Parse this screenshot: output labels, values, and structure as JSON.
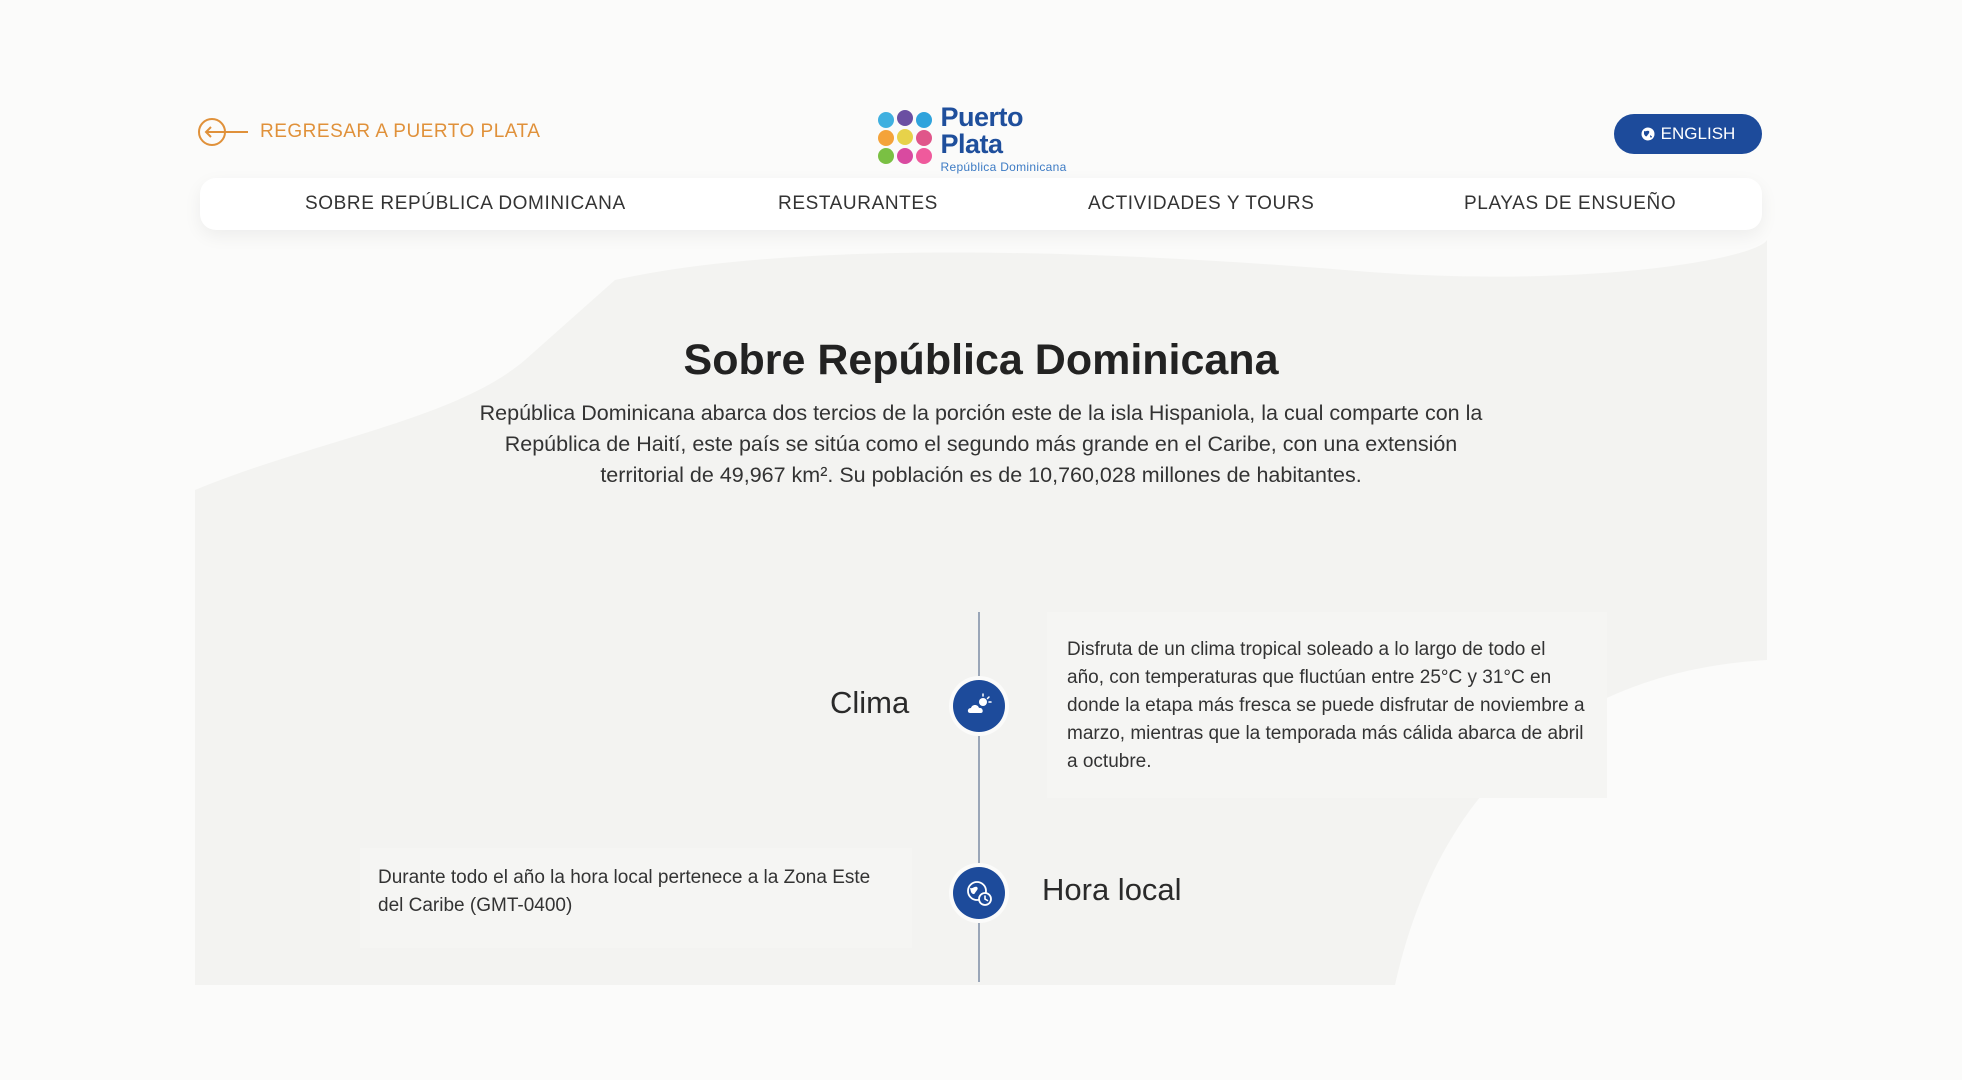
{
  "header": {
    "back_label": "REGRESAR A PUERTO PLATA",
    "logo": {
      "name": "Puerto Plata",
      "subtitle": "República Dominicana"
    },
    "language_button": "ENGLISH"
  },
  "nav": {
    "items": [
      {
        "label": "SOBRE REPÚBLICA DOMINICANA"
      },
      {
        "label": "RESTAURANTES"
      },
      {
        "label": "ACTIVIDADES Y TOURS"
      },
      {
        "label": "PLAYAS DE ENSUEÑO"
      }
    ]
  },
  "main": {
    "title": "Sobre República Dominicana",
    "intro": "República Dominicana abarca dos tercios de la porción este de la isla Hispaniola, la cual comparte con la República de Haití, este país se sitúa como el segundo más grande en el Caribe, con una extensión territorial de 49,967 km². Su población es de 10,760,028 millones de habitantes."
  },
  "timeline": {
    "items": [
      {
        "label": "Clima",
        "icon": "weather-icon",
        "text": "Disfruta de un clima tropical soleado a lo largo de todo el año, con temperaturas que fluctúan entre 25°C y 31°C en donde la etapa más fresca se puede disfrutar de noviembre a marzo, mientras que la temporada más cálida abarca de abril a octubre."
      },
      {
        "label": "Hora local",
        "icon": "clock-globe-icon",
        "text": "Durante todo el año la hora local pertenece a la Zona Este del Caribe (GMT-0400)"
      }
    ]
  },
  "colors": {
    "accent_orange": "#e0913a",
    "brand_blue": "#1d4b9b",
    "background": "#fbfbfa"
  }
}
